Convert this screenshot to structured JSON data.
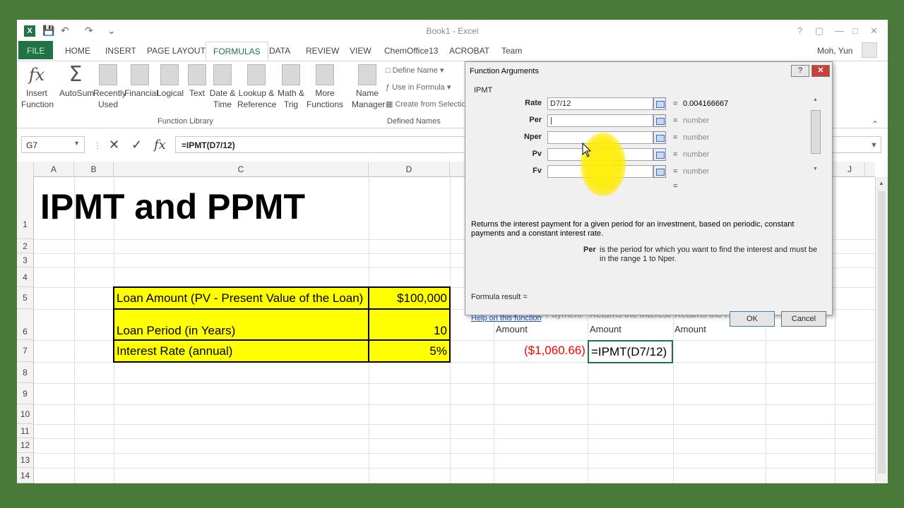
{
  "app": {
    "title": "Book1 - Excel",
    "logo": "X",
    "qat": [
      "save-icon",
      "undo-icon",
      "redo-icon",
      "customize-icon"
    ]
  },
  "tabs": [
    "FILE",
    "HOME",
    "INSERT",
    "PAGE LAYOUT",
    "FORMULAS",
    "DATA",
    "REVIEW",
    "VIEW",
    "ChemOffice13",
    "ACROBAT",
    "Team"
  ],
  "active_tab": "FORMULAS",
  "user": {
    "name": "Moh, Yun"
  },
  "ribbon": {
    "function_library": {
      "label": "Function Library",
      "buttons": [
        {
          "label": "Insert\nFunction",
          "icon": "fx-icon"
        },
        {
          "label": "AutoSum",
          "icon": "sigma-icon"
        },
        {
          "label": "Recently\nUsed",
          "icon": "star-book-icon"
        },
        {
          "label": "Financial",
          "icon": "book-icon"
        },
        {
          "label": "Logical",
          "icon": "question-book-icon"
        },
        {
          "label": "Text",
          "icon": "a-book-icon"
        },
        {
          "label": "Date &\nTime",
          "icon": "calendar-book-icon"
        },
        {
          "label": "Lookup &\nReference",
          "icon": "search-book-icon"
        },
        {
          "label": "Math &\nTrig",
          "icon": "theta-book-icon"
        },
        {
          "label": "More\nFunctions",
          "icon": "more-book-icon"
        }
      ]
    },
    "defined_names": {
      "label": "Defined Names",
      "name_manager": "Name\nManager",
      "define_name": "Define Name",
      "use_in_formula": "Use in Formula",
      "create_from_selection": "Create from Selectio"
    }
  },
  "formula_bar": {
    "name_box": "G7",
    "formula": "=IPMT(D7/12)"
  },
  "columns": [
    "A",
    "B",
    "C",
    "D",
    "J"
  ],
  "rows": [
    "1",
    "2",
    "3",
    "4",
    "5",
    "6",
    "7",
    "8",
    "9",
    "10",
    "11",
    "12",
    "13",
    "14"
  ],
  "sheet": {
    "title": "IPMT and PPMT",
    "loan_amount_label": "Loan Amount (PV - Present Value of the Loan)",
    "loan_amount_value": "$100,000",
    "loan_period_label": "Loan Period (in Years)",
    "loan_period_value": "10",
    "interest_rate_label": "Interest Rate (annual)",
    "interest_rate_value": "5%",
    "payment_header": "Returns the Payment",
    "payment_header_2": "Amount",
    "interest_header": "Returns the Interest",
    "interest_header_2": "Amount",
    "principal_header": "Returns the Principal",
    "principal_header_2": "Amount",
    "payment_value": "($1,060.66)",
    "active_cell_text": "=IPMT(D7/12)"
  },
  "dialog": {
    "title": "Function Arguments",
    "function_name": "IPMT",
    "args": [
      {
        "label": "Rate",
        "value": "D7/12",
        "result": "0.004166667"
      },
      {
        "label": "Per",
        "value": "|",
        "result": "number"
      },
      {
        "label": "Nper",
        "value": "",
        "result": "number"
      },
      {
        "label": "Pv",
        "value": "",
        "result": "number"
      },
      {
        "label": "Fv",
        "value": "",
        "result": "number"
      }
    ],
    "equals": "=",
    "description": "Returns the interest payment for a given period for an investment, based on periodic, constant payments and a constant interest rate.",
    "per_label": "Per",
    "per_description": "is the period for which you want to find the interest and must be in the range 1 to Nper.",
    "formula_result": "Formula result =",
    "help_link": "Help on this function",
    "ok": "OK",
    "cancel": "Cancel",
    "help_btn": "?",
    "close_btn": "✕"
  }
}
